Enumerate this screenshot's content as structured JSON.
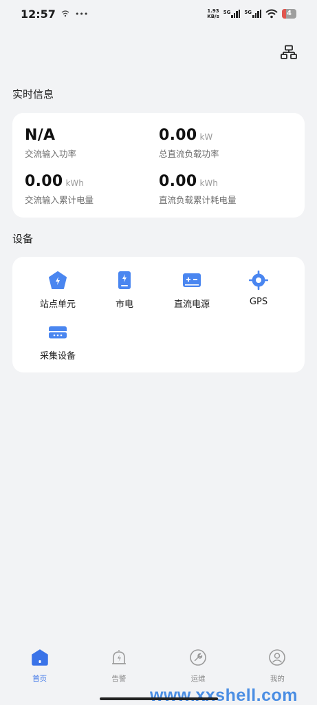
{
  "status_bar": {
    "time": "12:57",
    "net_speed_value": "1.93",
    "net_speed_unit": "KB/s",
    "sim1": "5G",
    "sim2": "5G",
    "battery": "4"
  },
  "sections": {
    "realtime_title": "实时信息",
    "devices_title": "设备"
  },
  "metrics": [
    {
      "value": "N/A",
      "unit": "",
      "label": "交流输入功率"
    },
    {
      "value": "0.00",
      "unit": "kW",
      "label": "总直流负载功率"
    },
    {
      "value": "0.00",
      "unit": "kWh",
      "label": "交流输入累计电量"
    },
    {
      "value": "0.00",
      "unit": "kWh",
      "label": "直流负载累计耗电量"
    }
  ],
  "devices": [
    {
      "label": "站点单元",
      "icon": "station-icon"
    },
    {
      "label": "市电",
      "icon": "mains-icon"
    },
    {
      "label": "直流电源",
      "icon": "dc-power-icon"
    },
    {
      "label": "GPS",
      "icon": "gps-icon"
    },
    {
      "label": "采集设备",
      "icon": "collector-icon"
    }
  ],
  "tabs": [
    {
      "label": "首页",
      "icon": "home-icon",
      "active": true
    },
    {
      "label": "告警",
      "icon": "alarm-icon",
      "active": false
    },
    {
      "label": "运维",
      "icon": "wrench-icon",
      "active": false
    },
    {
      "label": "我的",
      "icon": "profile-icon",
      "active": false
    }
  ],
  "watermark": "www.xxshell.com",
  "colors": {
    "accent": "#3a73e8",
    "icon_blue": "#4a86f0",
    "inactive": "#8a8a8a"
  }
}
